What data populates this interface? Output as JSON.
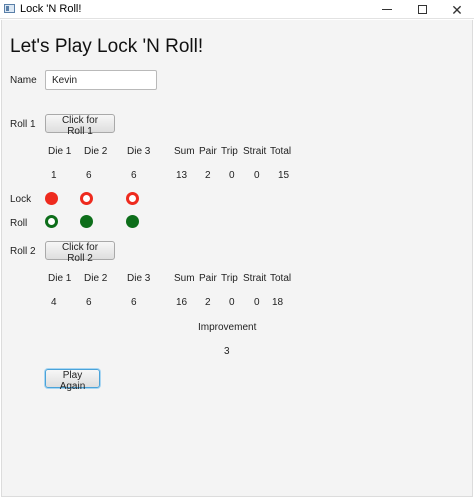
{
  "window": {
    "title": "Lock 'N Roll!",
    "minimize_icon": "minimize-icon",
    "maximize_icon": "maximize-icon",
    "close_icon": "close-icon"
  },
  "page_title": "Let's Play Lock 'N Roll!",
  "name": {
    "label": "Name",
    "value": "Kevin"
  },
  "roll1": {
    "label": "Roll 1",
    "button": "Click for Roll 1",
    "headers": {
      "die1": "Die 1",
      "die2": "Die 2",
      "die3": "Die 3",
      "sum": "Sum",
      "pair": "Pair",
      "trip": "Trip",
      "strait": "Strait",
      "total": "Total"
    },
    "values": {
      "die1": "1",
      "die2": "6",
      "die3": "6",
      "sum": "13",
      "pair": "2",
      "trip": "0",
      "strait": "0",
      "total": "15"
    }
  },
  "lock_row": {
    "label": "Lock",
    "die1": {
      "state": "selected",
      "color": "#ee2a1e"
    },
    "die2": {
      "state": "unselected",
      "color": "#ee2a1e"
    },
    "die3": {
      "state": "unselected",
      "color": "#ee2a1e"
    }
  },
  "roll_row": {
    "label": "Roll",
    "die1": {
      "state": "unselected",
      "color": "#0d6e1a"
    },
    "die2": {
      "state": "selected",
      "color": "#0d6e1a"
    },
    "die3": {
      "state": "selected",
      "color": "#0d6e1a"
    }
  },
  "roll2": {
    "label": "Roll 2",
    "button": "Click for Roll 2",
    "headers": {
      "die1": "Die 1",
      "die2": "Die 2",
      "die3": "Die 3",
      "sum": "Sum",
      "pair": "Pair",
      "trip": "Trip",
      "strait": "Strait",
      "total": "Total"
    },
    "values": {
      "die1": "4",
      "die2": "6",
      "die3": "6",
      "sum": "16",
      "pair": "2",
      "trip": "0",
      "strait": "0",
      "total": "18"
    }
  },
  "improvement": {
    "label": "Improvement",
    "value": "3"
  },
  "play_again": "Play Again"
}
